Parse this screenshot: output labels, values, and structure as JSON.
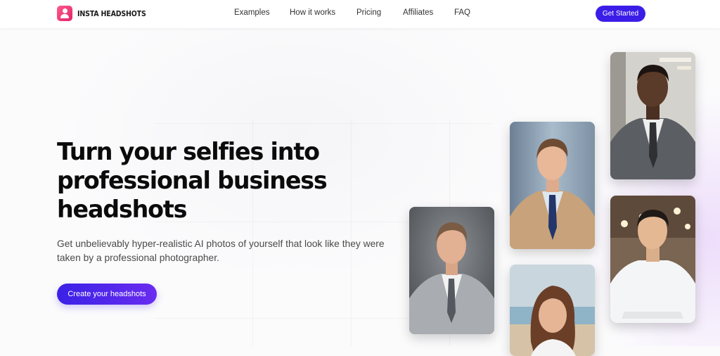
{
  "brand": {
    "name": "INSTA HEADSHOTS"
  },
  "nav": {
    "links": [
      "Examples",
      "How it works",
      "Pricing",
      "Affiliates",
      "FAQ"
    ],
    "cta": "Get Started"
  },
  "hero": {
    "title_lines": [
      "Turn your selfies into",
      "professional business",
      "headshots"
    ],
    "subtitle": "Get unbelievably hyper-realistic AI photos of yourself that look like they were taken by a professional photographer.",
    "cta": "Create your headshots"
  },
  "colors": {
    "accent": "#3b1de8",
    "brand_pink": "#e0246b"
  },
  "photos": [
    "headshot-man-grey-suit",
    "headshot-man-tan-blazer",
    "headshot-woman-beach",
    "headshot-man-office-grey-suit",
    "headshot-man-cafe-white-shirt"
  ]
}
